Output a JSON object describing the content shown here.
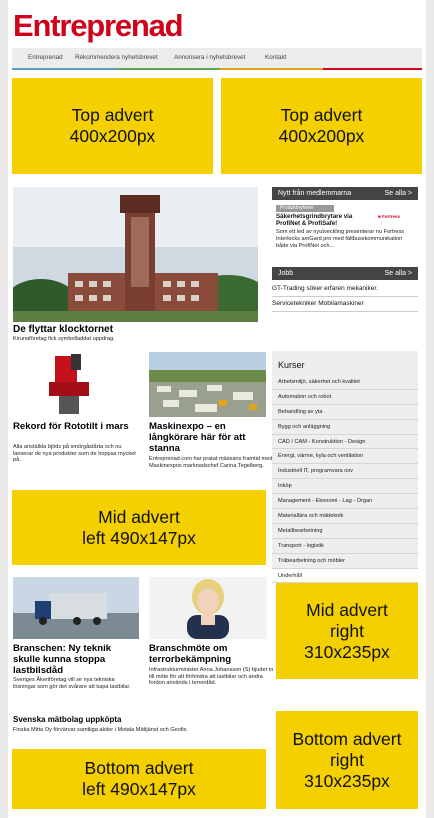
{
  "site": {
    "logo": "Entreprenad",
    "nav": [
      "Entreprenad",
      "Rekommendera nyhetsbrevet",
      "Annonsera i nyhetsbrevet",
      "Kontakt"
    ]
  },
  "adverts": {
    "top_left": "Top advert\n400x200px",
    "top_right": "Top advert\n400x200px",
    "mid_left": "Mid advert\nleft 490x147px",
    "mid_right": "Mid advert\nright\n310x235px",
    "bottom_left": "Bottom advert\nleft 490x147px",
    "bottom_right": "Bottom advert\nright\n310x235px"
  },
  "main": {
    "lead": {
      "title": "De flyttar klocktornet",
      "teaser": "Kirunaföretag fick symbolladdat uppdrag."
    },
    "article_2": {
      "title": "Rekord för Rototilt i mars",
      "teaser": "Alla anställda bjöds på smörgåstårta och nu lanserar de nya produkter som de hoppas mycket på."
    },
    "article_3": {
      "title": "Maskinexpo – en långkörare här för att stanna",
      "teaser": "Entreprenad.com har pratat mässans framtid med Maskinexpos marknadschef Carina Tegelberg."
    },
    "article_4": {
      "title": "Branschen: Ny teknik skulle kunna stoppa lastbilsdåd",
      "teaser": "Sveriges Åkeriföretag vill se nya tekniska lösningar som gör det svårare att kapa lastbilar."
    },
    "article_5": {
      "title": "Branschmöte om terrorbekämpning",
      "teaser": "Infrastrukturminister Anna Johansson (S) bjuder in till möte för att förhindra att lastbilar och andra fordon används i terrordåd."
    },
    "article_6": {
      "title": "Svenska mätbolag uppköpta",
      "teaser": "Finska Mitta Oy förvärvar samtliga aktier i Motala Mätljänst och Geofix."
    }
  },
  "sidebar": {
    "members": {
      "title": "Nytt från medlemmarna",
      "see_all": "Se alla >",
      "tag": "Produktnyheter",
      "item_title": "Säkerhetsgrindbrytare via ProfiNet & ProfiSafe!",
      "item_text": "Som ett led av nyutveckling presenterar nu Fortress Interlocks amGard pro med fältbusskommunikation både via ProfiNet och..."
    },
    "jobs": {
      "title": "Jobb",
      "see_all": "Se alla >",
      "items": [
        "GT-Trading söker erfaren mekaniker.",
        "Servicetekniker Mobilamaskiner"
      ]
    },
    "courses": {
      "title": "Kurser",
      "items": [
        "Arbetsmiljö, säkerhet och kvalitet",
        "Automation och robot",
        "Behandling av yta",
        "Bygg och anläggning",
        "CAD / CAM - Konstruktion - Design",
        "Energi, värme, kyla och ventilation",
        "Industriell IT, programvara osv",
        "Inköp",
        "Management - Ekonomi - Lag - Organ",
        "Materiallära och mätteknik",
        "Metallbearbetning",
        "Transport - logistik",
        "Träbearbetning och möbler",
        "Underhåll"
      ]
    }
  },
  "colors": {
    "brand": "#d0021b",
    "advert": "#f5d000",
    "nav_lines": [
      "#5a9fc8",
      "#5aa85a",
      "#e3a21a",
      "#d0021b"
    ]
  }
}
